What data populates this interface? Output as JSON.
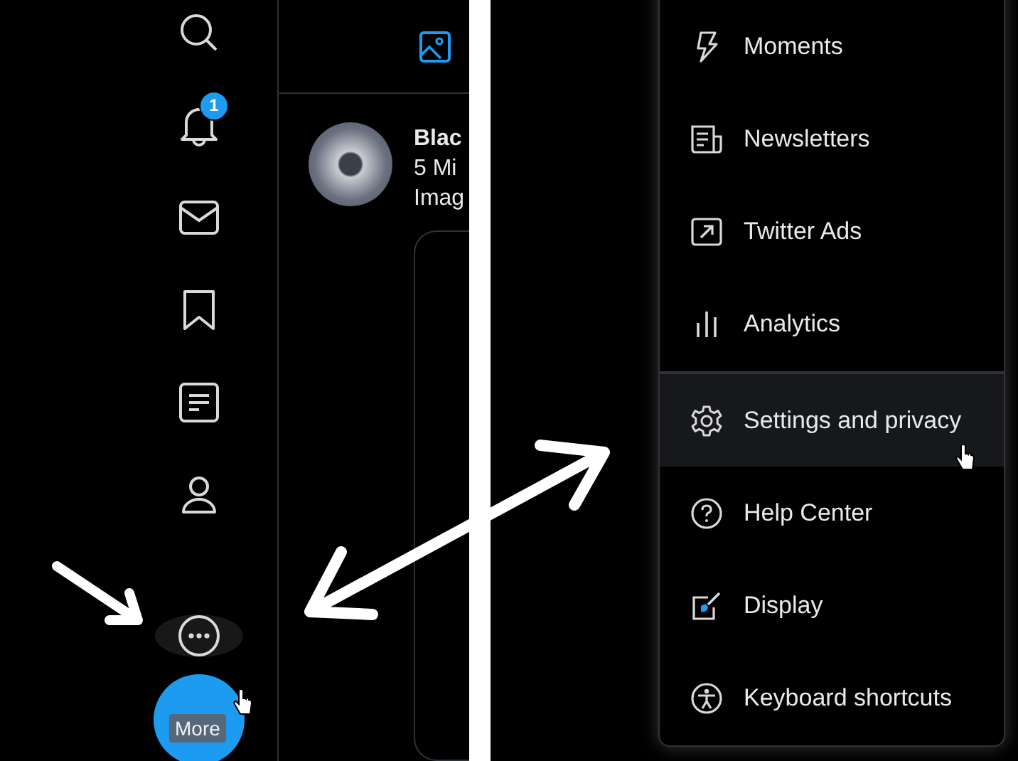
{
  "sidebar": {
    "items": [
      {
        "kind": "search"
      },
      {
        "kind": "notifications",
        "badge": "1"
      },
      {
        "kind": "messages"
      },
      {
        "kind": "bookmarks"
      },
      {
        "kind": "lists"
      },
      {
        "kind": "profile"
      }
    ],
    "more_button": {
      "tooltip": "More"
    }
  },
  "feed": {
    "post": {
      "name": "Blac",
      "line_2": "5 Mi",
      "line_3": "Imag"
    }
  },
  "menu": {
    "groups": [
      [
        {
          "kind": "moments",
          "label": "Moments",
          "selected": false
        },
        {
          "kind": "newsletters",
          "label": "Newsletters",
          "selected": false
        },
        {
          "kind": "ads",
          "label": "Twitter Ads",
          "selected": false
        },
        {
          "kind": "analytics",
          "label": "Analytics",
          "selected": false
        }
      ],
      [
        {
          "kind": "settings",
          "label": "Settings and privacy",
          "selected": true
        },
        {
          "kind": "help",
          "label": "Help Center",
          "selected": false
        },
        {
          "kind": "display",
          "label": "Display",
          "selected": false
        },
        {
          "kind": "keyboard",
          "label": "Keyboard shortcuts",
          "selected": false
        }
      ]
    ]
  }
}
